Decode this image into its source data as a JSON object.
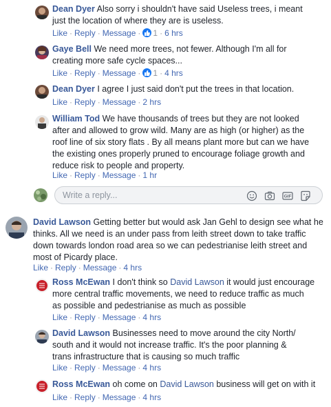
{
  "comments": [
    {
      "author": "Dean Dyer",
      "text": "Also sorry i shouldn't have said Useless trees, i meant just the location of where they are is useless.",
      "line1": "Also sorry i shouldn't have said Useless trees, i meant",
      "line2": "just the location of where they are is useless.",
      "like": "Like",
      "reply": "Reply",
      "message": "Message",
      "reactions": "1",
      "time": "6 hrs"
    },
    {
      "author": "Gaye Bell",
      "line1": "We need more trees, not fewer. Although I'm all for",
      "line2": "creating more safe cycle spaces...",
      "like": "Like",
      "reply": "Reply",
      "message": "Message",
      "reactions": "1",
      "time": "4 hrs"
    },
    {
      "author": "Dean Dyer",
      "line1": "I agree I just said don't put the trees in that location.",
      "like": "Like",
      "reply": "Reply",
      "message": "Message",
      "time": "2 hrs"
    },
    {
      "author": "William Tod",
      "line1": "We have thousands of trees but they are not looked",
      "line2": "after and allowed to grow wild. Many are as high (or higher) as the",
      "line3": "roof line of six story flats . By all means plant more but can we have",
      "line4": "the existing ones properly pruned to encourage foliage growth and",
      "line5": "reduce risk to people and property.",
      "like": "Like",
      "reply": "Reply",
      "message": "Message",
      "time": "1 hr"
    },
    {
      "author": "David Lawson",
      "line1": "Getting better but would ask Jan Gehl to design see what he",
      "line2": "thinks. All we need is an under pass from leith street down to take traffic",
      "line3": "down towards london road area so we can pedestrianise leith street and",
      "line4": "most of Picardy place.",
      "like": "Like",
      "reply": "Reply",
      "message": "Message",
      "time": "4 hrs"
    },
    {
      "author": "Ross McEwan",
      "line1_a": "I don't think so",
      "mention": "David Lawson",
      "line1_b": "it would just encourage",
      "line2": "more central traffic movements, we need to reduce traffic as much",
      "line3": "as possible and pedestrianise as much as possible",
      "like": "Like",
      "reply": "Reply",
      "message": "Message",
      "time": "4 hrs"
    },
    {
      "author": "David Lawson",
      "line1": "Businesses need to move around the city North/",
      "line2": "south and it would not increase traffic. It's the poor planning &",
      "line3": "trans infrastructure that is causing so much traffic",
      "like": "Like",
      "reply": "Reply",
      "message": "Message",
      "time": "4 hrs"
    },
    {
      "author": "Ross McEwan",
      "line1_a": "oh come on",
      "mention": "David Lawson",
      "line1_b": "business will get on with it",
      "like": "Like",
      "reply": "Reply",
      "message": "Message",
      "time": "4 hrs"
    }
  ],
  "reply_box": {
    "placeholder": "Write a reply...",
    "icons": [
      "emoji-icon",
      "camera-icon",
      "gif-icon",
      "sticker-icon"
    ]
  },
  "colors": {
    "link": "#385898",
    "action": "#4267b2",
    "meta": "#90949c",
    "reaction": "#1877f2"
  }
}
